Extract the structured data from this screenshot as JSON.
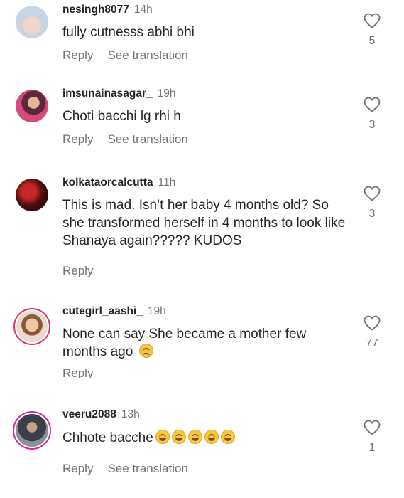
{
  "actions": {
    "reply": "Reply",
    "translate": "See translation"
  },
  "comments": [
    {
      "username": "nesingh8077",
      "time": "14h",
      "text": "fully cutnesss abhi bhi",
      "likes": "5",
      "show_translate": true
    },
    {
      "username": "imsunainasagar_",
      "time": "19h",
      "text": "Choti bacchi lg rhi h",
      "likes": "3",
      "show_translate": true
    },
    {
      "username": "kolkataorcalcutta",
      "time": "11h",
      "text": "This is mad. Isn’t her baby 4 months old? So she transformed herself in 4 months to look like Shanaya again????? KUDOS",
      "likes": "3",
      "show_translate": false
    },
    {
      "username": "cutegirl_aashi_",
      "time": "19h",
      "text": "None can say She became a mother few months ago",
      "likes": "77",
      "show_translate": false,
      "emoji": "pleading-face"
    },
    {
      "username": "veeru2088",
      "time": "13h",
      "text": "Chhote bacche",
      "likes": "1",
      "show_translate": true,
      "emoji": "grinning-squinting-face x5"
    }
  ],
  "colors": {
    "text": "#262626",
    "secondary": "#737373",
    "story_ring": "#e1306c"
  }
}
